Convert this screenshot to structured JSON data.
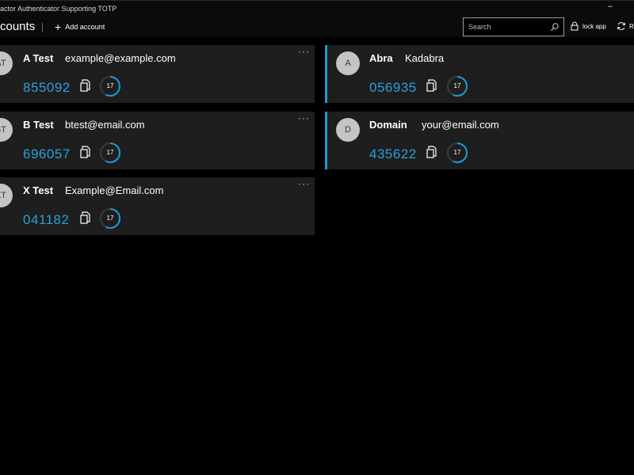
{
  "window": {
    "title": "actor Authenticator Supporting TOTP",
    "minimize": "–"
  },
  "header": {
    "page_title": "counts",
    "add_account_label": "Add account",
    "search_placeholder": "Search",
    "lock_label": "lock app",
    "refresh_label": "R"
  },
  "colors": {
    "accent": "#1a9bd7",
    "code": "#2a9fd8",
    "card_bg": "#1e1e1e",
    "background": "#000000"
  },
  "accounts": [
    {
      "initials": "AT",
      "name": "A Test",
      "account": "example@example.com",
      "code": "855092",
      "seconds": "17",
      "remaining_fraction": 0.57
    },
    {
      "initials": "A",
      "name": "Abra",
      "account": "Kadabra",
      "code": "056935",
      "seconds": "17",
      "remaining_fraction": 0.57
    },
    {
      "initials": "BT",
      "name": "B Test",
      "account": "btest@email.com",
      "code": "696057",
      "seconds": "17",
      "remaining_fraction": 0.57
    },
    {
      "initials": "D",
      "name": "Domain",
      "account": "your@email.com",
      "code": "435622",
      "seconds": "17",
      "remaining_fraction": 0.57
    },
    {
      "initials": "XT",
      "name": "X Test",
      "account": "Example@Email.com",
      "code": "041182",
      "seconds": "17",
      "remaining_fraction": 0.57
    }
  ],
  "card_menu": "···"
}
